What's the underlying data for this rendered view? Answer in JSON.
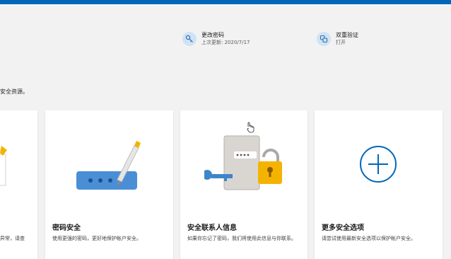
{
  "header": {
    "accent_color": "#0067b8"
  },
  "quick_links": [
    {
      "icon": "key-icon",
      "title": "更改密码",
      "subtitle": "上次更新: 2020/7/17"
    },
    {
      "icon": "two-step-icon",
      "title": "双重验证",
      "subtitle": "打开"
    }
  ],
  "intro_text": "安全资源。",
  "cards": [
    {
      "title": "",
      "description": "异常，请查"
    },
    {
      "title": "密码安全",
      "description": "使用更强的密码，更好地保护帐户安全。",
      "art": "password-field-pen-icon"
    },
    {
      "title": "安全联系人信息",
      "description": "如果你忘记了密码，我们将使用此信息与你联系。",
      "art": "contact-book-lock-icon"
    },
    {
      "title": "更多安全选项",
      "description": "请尝试使用最新安全选项以保护帐户安全。",
      "art": "add-circle-icon"
    }
  ]
}
